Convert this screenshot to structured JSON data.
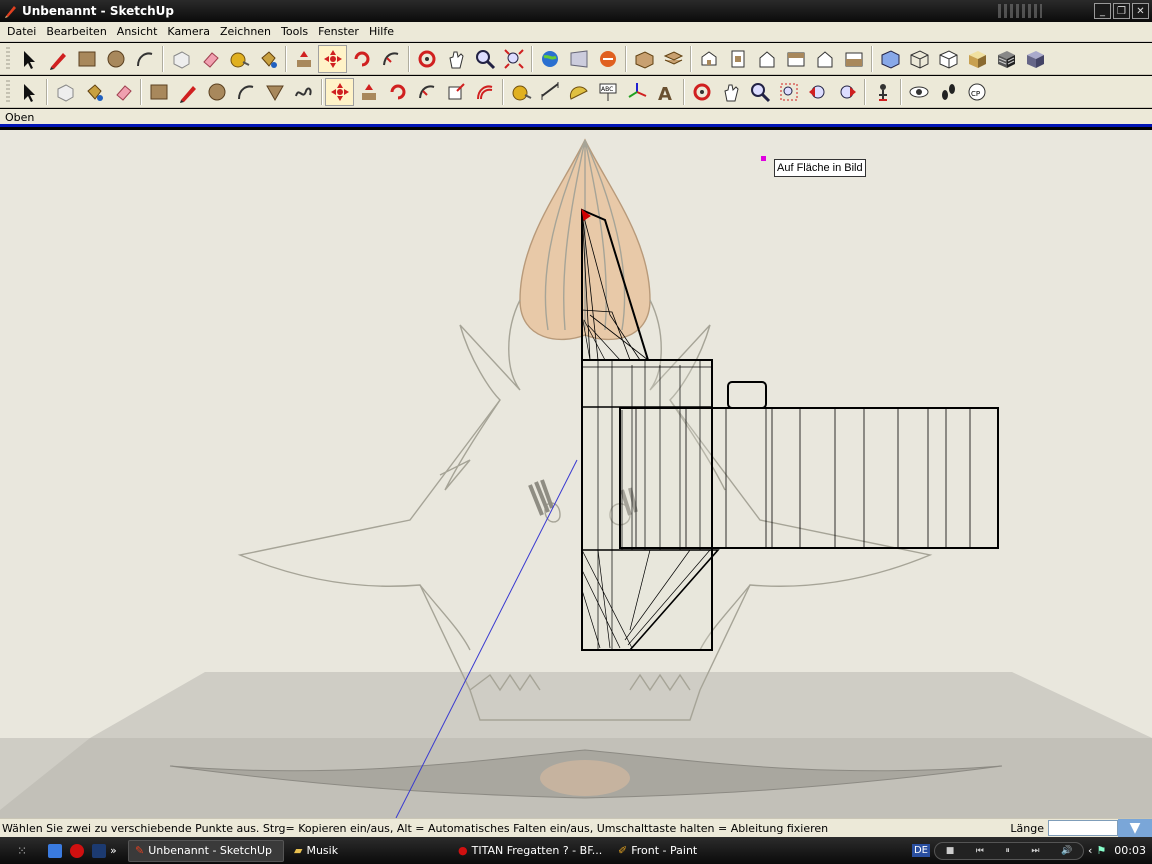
{
  "window": {
    "title": "Unbenannt - SketchUp"
  },
  "menu": [
    "Datei",
    "Bearbeiten",
    "Ansicht",
    "Kamera",
    "Zeichnen",
    "Tools",
    "Fenster",
    "Hilfe"
  ],
  "toolbar1": [
    "select-icon",
    "pencil-icon",
    "rectangle-icon",
    "circle-icon",
    "arc-icon",
    "make-component-icon",
    "eraser-icon",
    "tape-measure-icon",
    "paint-bucket-icon",
    "push-pull-icon",
    "move-icon",
    "rotate-icon",
    "follow-me-icon",
    "orbit-icon",
    "pan-icon",
    "zoom-icon",
    "zoom-extents-icon",
    "google-earth-icon",
    "get-models-icon",
    "share-model-icon",
    "component-icon",
    "layer-icon",
    "iso-view-icon",
    "top-view-icon",
    "front-view-icon",
    "right-view-icon",
    "back-view-icon",
    "left-view-icon",
    "xray-icon",
    "wireframe-icon",
    "hidden-line-icon",
    "shaded-icon",
    "shaded-texture-icon",
    "monochrome-icon"
  ],
  "toolbar2": [
    "select-icon",
    "make-component-icon",
    "paint-bucket-icon",
    "eraser-icon",
    "rectangle-icon",
    "pencil-icon",
    "circle-icon",
    "arc-icon",
    "polygon-icon",
    "freehand-icon",
    "move-icon",
    "push-pull-icon",
    "rotate-icon",
    "follow-me-icon",
    "scale-icon",
    "offset-icon",
    "tape-measure-icon",
    "dimension-icon",
    "protractor-icon",
    "text-icon",
    "axes-icon",
    "3d-text-icon",
    "orbit-icon",
    "pan-icon",
    "zoom-icon",
    "zoom-window-icon",
    "previous-view-icon",
    "next-view-icon",
    "position-camera-icon",
    "look-around-icon",
    "walk-icon",
    "section-plane-icon"
  ],
  "scene_tab": "Oben",
  "viewport": {
    "tooltip": "Auf Fläche in Bild",
    "colors": {
      "background": "#e9e7dd",
      "ground": "#c9c7bf",
      "nose": "#e8c9a8",
      "axis": "#3a3ad0"
    }
  },
  "status": {
    "message": "Wählen Sie zwei zu verschiebende Punkte aus.  Strg= Kopieren ein/aus, Alt = Automatisches Falten ein/aus, Umschalttaste halten = Ableitung fixieren",
    "vcb_label": "Länge",
    "vcb_value": ""
  },
  "taskbar": {
    "quicklaunch": [
      "ie-icon",
      "opera-icon",
      "photoshop-icon"
    ],
    "tasks": [
      {
        "label": "Unbenannt - SketchUp",
        "icon": "sketchup-icon",
        "active": true
      },
      {
        "label": "Musik",
        "icon": "folder-icon",
        "active": false
      },
      {
        "label": "TITAN Fregatten ? - BF...",
        "icon": "opera-icon",
        "active": false
      },
      {
        "label": "Front - Paint",
        "icon": "paint-icon",
        "active": false
      }
    ],
    "language": "DE",
    "clock": "00:03"
  }
}
